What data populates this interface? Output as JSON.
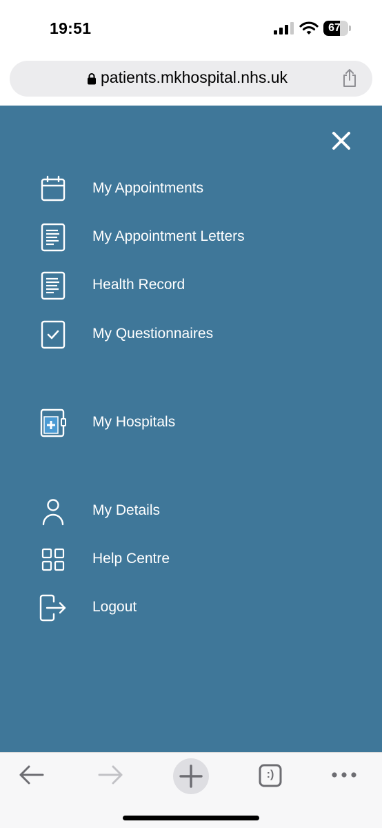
{
  "status_bar": {
    "time": "19:51",
    "battery_level": "67",
    "battery_fraction": 0.67
  },
  "browser": {
    "url": "patients.mkhospital.nhs.uk",
    "icons": [
      "lock-icon",
      "share-icon",
      "back-arrow-icon",
      "forward-arrow-icon",
      "plus-icon",
      "tabs-icon",
      "more-icon"
    ],
    "tabs_label": ":)"
  },
  "menu": {
    "background_color": "#3f7799",
    "close_icon": "close-icon",
    "items": [
      {
        "label": "My Appointments",
        "icon": "calendar-icon"
      },
      {
        "label": "My Appointment Letters",
        "icon": "document-icon"
      },
      {
        "label": "Health Record",
        "icon": "document-icon"
      },
      {
        "label": "My Questionnaires",
        "icon": "checklist-icon"
      },
      {
        "label": "My Hospitals",
        "icon": "hospital-icon"
      },
      {
        "label": "My Details",
        "icon": "person-icon"
      },
      {
        "label": "Help Centre",
        "icon": "grid-icon"
      },
      {
        "label": "Logout",
        "icon": "logout-icon"
      }
    ]
  }
}
